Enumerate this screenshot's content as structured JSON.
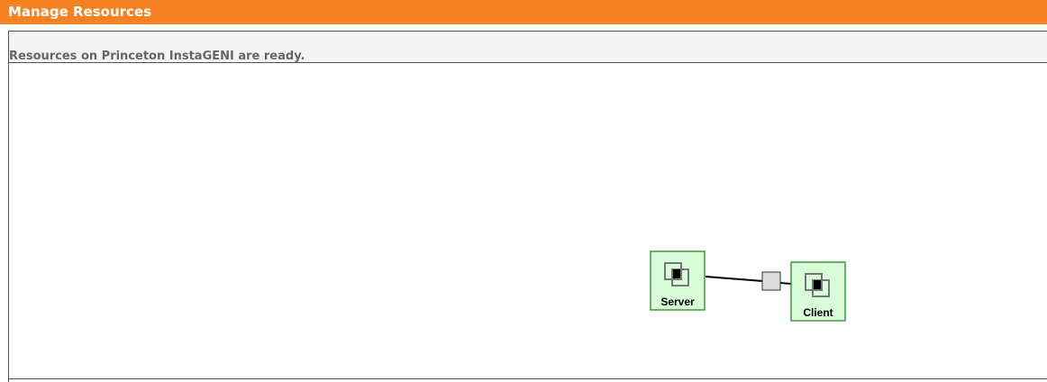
{
  "header": {
    "title": "Manage Resources"
  },
  "status": {
    "message": "Resources on Princeton InstaGENI are ready."
  },
  "topology": {
    "nodes": [
      {
        "id": "server",
        "label": "Server",
        "icon": "vm-icon"
      },
      {
        "id": "client",
        "label": "Client",
        "icon": "vm-icon"
      }
    ],
    "link": {
      "icon": "lan-link-square"
    }
  },
  "colors": {
    "header_bg": "#f68121",
    "node_fill": "#d9fcd9",
    "node_border": "#3c9a3c",
    "link_fill": "#dddddd",
    "status_text": "#666666"
  }
}
